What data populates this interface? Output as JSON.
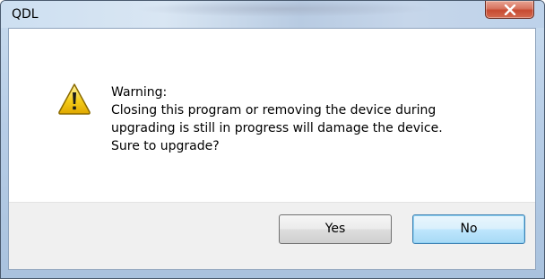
{
  "window": {
    "title": "QDL",
    "close_symbol": "x"
  },
  "message": {
    "icon": "warning-icon",
    "lines": [
      "Warning:",
      "Closing this program or removing the device during",
      "upgrading is still in progress will damage the device.",
      "Sure to upgrade?"
    ]
  },
  "buttons": {
    "yes_label": "Yes",
    "no_label": "No"
  },
  "colors": {
    "warning_fill": "#f2c200",
    "warning_outline": "#8a6a00",
    "focused_button_border": "#3c7fb1"
  }
}
